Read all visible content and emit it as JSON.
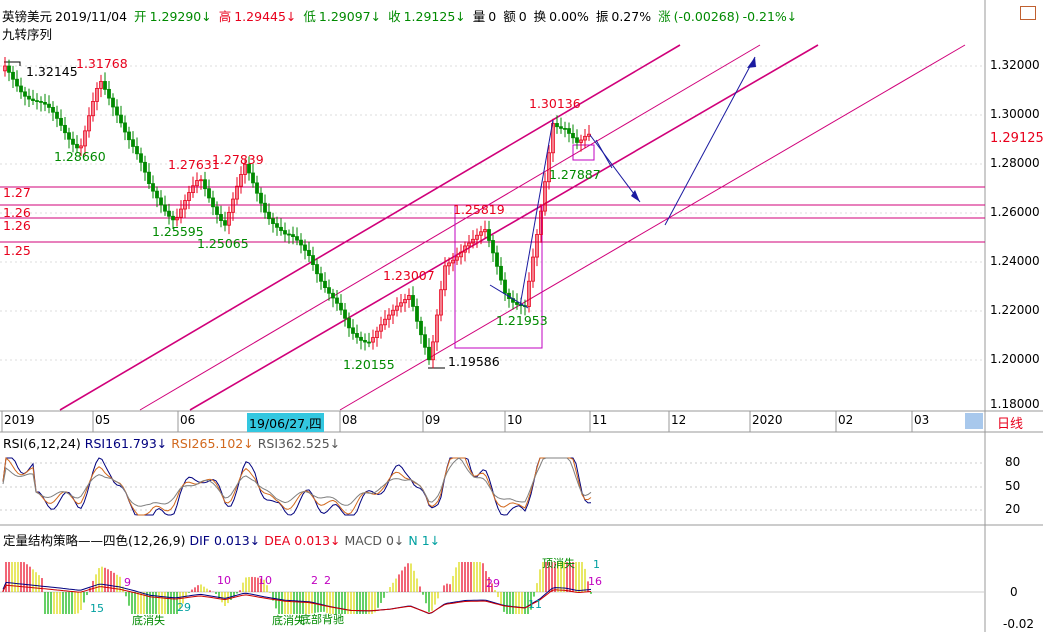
{
  "header": {
    "symbol": "英镑美元",
    "date": "2019/11/04",
    "open_label": "开",
    "open": "1.29290↓",
    "high_label": "高",
    "high": "1.29445↓",
    "low_label": "低",
    "low": "1.29097↓",
    "close_label": "收",
    "close": "1.29125↓",
    "vol_label": "量",
    "vol": "0",
    "amt_label": "额",
    "amt": "0",
    "turn_label": "换",
    "turn": "0.00%",
    "amp_label": "振",
    "amp": "0.27%",
    "chg_label": "涨",
    "chg": "(-0.00268)",
    "chg_pct": "-0.21%↓",
    "indicator_name": "九转序列"
  },
  "price_axis": [
    "1.32000",
    "1.30000",
    "1.29125",
    "1.28000",
    "1.26000",
    "1.24000",
    "1.22000",
    "1.20000",
    "1.18000"
  ],
  "current_price": "1.29125",
  "time_axis": [
    "2019",
    "05",
    "06",
    "19/06/27,四",
    "08",
    "09",
    "10",
    "11",
    "12",
    "2020",
    "02",
    "03"
  ],
  "period_label": "日线",
  "h_lines": [
    "1.27",
    "1.26",
    "1.26",
    "1.25"
  ],
  "annotations": {
    "red": [
      "1.31768",
      "1.27631",
      "1.27839",
      "1.25819",
      "1.23007",
      "1.30136"
    ],
    "green": [
      "1.28660",
      "1.25595",
      "1.25065",
      "1.20155",
      "1.21953",
      "1.27887"
    ],
    "black": [
      "1.32145",
      "1.19586"
    ]
  },
  "rsi": {
    "title": "RSI(6,12,24)",
    "rsi1_label": "RSI1",
    "rsi1": "61.793↓",
    "rsi2_label": "RSI2",
    "rsi2": "65.102↓",
    "rsi3_label": "RSI3",
    "rsi3": "62.525↓",
    "axis": [
      "80",
      "50",
      "20"
    ]
  },
  "macd": {
    "title": "定量结构策略——四色(12,26,9)",
    "dif_label": "DIF",
    "dif": "0.013↓",
    "dea_label": "DEA",
    "dea": "0.013↓",
    "macd_label": "MACD",
    "macd": "0↓",
    "n_label": "N",
    "n": "1↓",
    "axis": [
      "0",
      "-0.02"
    ],
    "notes": [
      "9",
      "10",
      "10",
      "2",
      "2",
      "29",
      "15",
      "29",
      "11",
      "16",
      "1"
    ],
    "texts": [
      "底消失",
      "底消失",
      "底部背驰",
      "顶消失"
    ]
  },
  "colors": {
    "up": "#e8001c",
    "down": "#008a00",
    "channel": "#d0007a",
    "rsi1": "#00007e",
    "rsi2": "#d2691e",
    "rsi3": "#808080"
  }
}
